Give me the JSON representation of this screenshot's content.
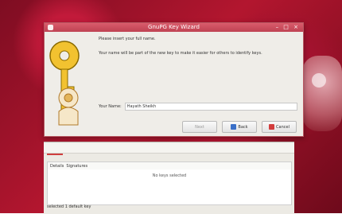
{
  "window": {
    "title": "GnuPG Key Wizard",
    "controls": "– □ ×"
  },
  "dialog": {
    "prompt": "Please insert your full name.",
    "description": "Your name will be part of the new key to make it easier for others to identify keys.",
    "name_label": "Your Name:",
    "name_value": "Hayath Sheikh",
    "buttons": {
      "next": "Next",
      "back": "Back",
      "cancel": "Cancel"
    }
  },
  "background": {
    "columns": [
      "Details",
      "Signatures"
    ],
    "empty_list": "No keys selected",
    "status": "selected 1 default key"
  },
  "colors": {
    "titlebar": "#d95b6b",
    "accent": "#3a6fc8",
    "danger": "#d23d3d"
  },
  "icons": {
    "key": "key-icon",
    "user": "user-icon"
  }
}
